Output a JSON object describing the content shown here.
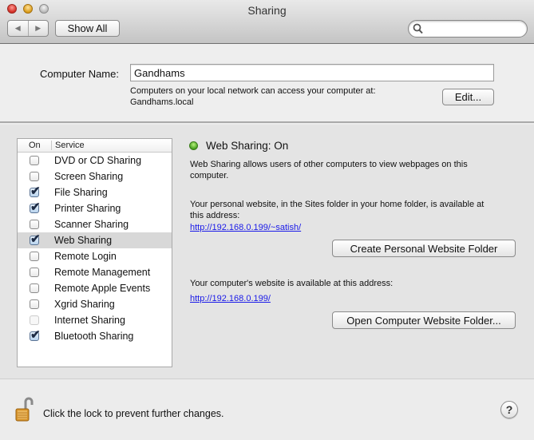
{
  "window": {
    "title": "Sharing",
    "show_all_label": "Show All",
    "search_placeholder": "",
    "back_icon": "◀",
    "forward_icon": "▶"
  },
  "computer_name": {
    "label": "Computer Name:",
    "value": "Gandhams",
    "info_line1": "Computers on your local network can access your computer at:",
    "info_line2": "Gandhams.local",
    "edit_label": "Edit..."
  },
  "services": {
    "col_on": "On",
    "col_service": "Service",
    "items": [
      {
        "name": "DVD or CD Sharing",
        "checked": false,
        "enabled": true,
        "selected": false
      },
      {
        "name": "Screen Sharing",
        "checked": false,
        "enabled": true,
        "selected": false
      },
      {
        "name": "File Sharing",
        "checked": true,
        "enabled": true,
        "selected": false
      },
      {
        "name": "Printer Sharing",
        "checked": true,
        "enabled": true,
        "selected": false
      },
      {
        "name": "Scanner Sharing",
        "checked": false,
        "enabled": true,
        "selected": false
      },
      {
        "name": "Web Sharing",
        "checked": true,
        "enabled": true,
        "selected": true
      },
      {
        "name": "Remote Login",
        "checked": false,
        "enabled": true,
        "selected": false
      },
      {
        "name": "Remote Management",
        "checked": false,
        "enabled": true,
        "selected": false
      },
      {
        "name": "Remote Apple Events",
        "checked": false,
        "enabled": true,
        "selected": false
      },
      {
        "name": "Xgrid Sharing",
        "checked": false,
        "enabled": true,
        "selected": false
      },
      {
        "name": "Internet Sharing",
        "checked": false,
        "enabled": false,
        "selected": false
      },
      {
        "name": "Bluetooth Sharing",
        "checked": true,
        "enabled": true,
        "selected": false
      }
    ]
  },
  "detail": {
    "status": "Web Sharing: On",
    "status_color": "#4caf1f",
    "description_line1": "Web Sharing allows users of other computers to view webpages on this",
    "description_line2": "computer.",
    "personal_line1": "Your personal website, in the Sites folder in your home folder, is available at",
    "personal_line2": "this address:",
    "personal_url": "http://192.168.0.199/~satish/",
    "create_folder_label": "Create Personal Website Folder",
    "computer_site_text": "Your computer's website is available at this address:",
    "computer_url": "http://192.168.0.199/",
    "open_folder_label": "Open Computer Website Folder..."
  },
  "footer": {
    "lock_text": "Click the lock to prevent further changes.",
    "lock_state": "unlocked",
    "help_label": "?"
  }
}
